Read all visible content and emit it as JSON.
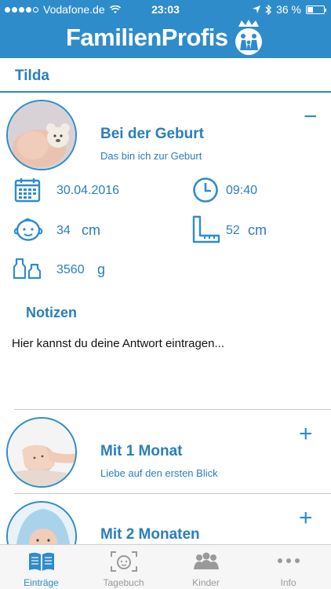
{
  "status_bar": {
    "carrier": "Vodafone.de",
    "time": "23:03",
    "battery": "36 %",
    "battery_level": 0.36
  },
  "header": {
    "brand": "FamilienProfis",
    "logo_icon": "crown-family-logo"
  },
  "child": {
    "name": "Tilda"
  },
  "sections": [
    {
      "title": "Bei der Geburt",
      "subtitle": "Das bin ich zur Geburt",
      "toggle": "−",
      "expanded": true,
      "fields": {
        "date": "30.04.2016",
        "time": "09:40",
        "head_value": "34",
        "head_unit": "cm",
        "length_value": "52",
        "length_unit": "cm",
        "weight_value": "3560",
        "weight_unit": "g"
      },
      "notes_title": "Notizen",
      "notes_placeholder": "Hier kannst du deine Antwort eintragen..."
    },
    {
      "title": "Mit 1 Monat",
      "subtitle": "Liebe auf den ersten Blick",
      "toggle": "+",
      "expanded": false
    },
    {
      "title": "Mit 2 Monaten",
      "toggle": "+",
      "expanded": false
    }
  ],
  "tabs": [
    {
      "label": "Einträge",
      "icon": "book-icon",
      "active": true
    },
    {
      "label": "Tagebuch",
      "icon": "baby-face-scan-icon",
      "active": false
    },
    {
      "label": "Kinder",
      "icon": "children-group-icon",
      "active": false
    },
    {
      "label": "Info",
      "icon": "more-dots-icon",
      "active": false
    }
  ],
  "colors": {
    "primary": "#2e8ccb",
    "text_accent": "#2a7fba",
    "tab_inactive": "#9a9a9a"
  }
}
